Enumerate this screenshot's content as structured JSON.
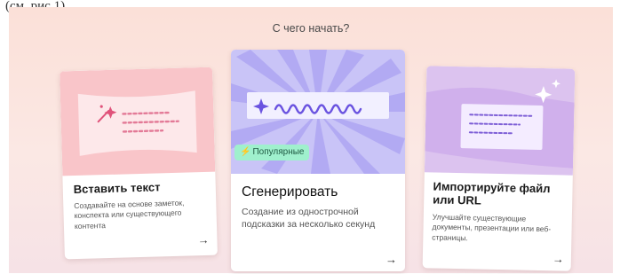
{
  "caption": "(см. рис 1).",
  "heading": "С чего начать?",
  "cards": [
    {
      "title": "Вставить текст",
      "description": "Создавайте на основе заметок, конспекта или существующего контента",
      "arrow": "→"
    },
    {
      "badge": "Популярные",
      "title": "Сгенерировать",
      "description": "Создание из однострочной подсказки за несколько секунд",
      "arrow": "→"
    },
    {
      "title": "Импортируйте файл или URL",
      "description": "Улучшайте существующие документы, презентации или веб-страницы.",
      "arrow": "→"
    }
  ],
  "colors": {
    "background": "#fbe3dc",
    "paste_art": "#f9c5c9",
    "generate_art": "#c9c4f7",
    "import_art": "#dcc3ef",
    "badge": "#9ff0cd",
    "accent_purple": "#6a53e0"
  },
  "icons": {
    "paste": "magic-wand-icon",
    "generate": "sparkle-icon",
    "badge": "lightning-icon",
    "import": "sparkle-icon",
    "arrow": "arrow-right-icon"
  }
}
